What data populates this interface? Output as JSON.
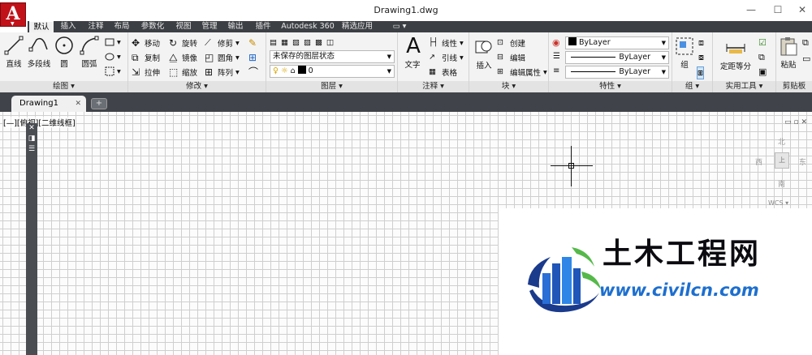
{
  "window": {
    "title": "Drawing1.dwg",
    "app_button": "A",
    "controls": [
      "—",
      "☐",
      "✕"
    ]
  },
  "menu": {
    "tabs": [
      {
        "label": "默认",
        "active": true
      },
      {
        "label": "插入",
        "active": false
      },
      {
        "label": "注释",
        "active": false
      },
      {
        "label": "布局",
        "active": false
      },
      {
        "label": "参数化",
        "active": false
      },
      {
        "label": "视图",
        "active": false
      },
      {
        "label": "管理",
        "active": false
      },
      {
        "label": "输出",
        "active": false
      },
      {
        "label": "插件",
        "active": false
      },
      {
        "label": "Autodesk 360",
        "active": false
      },
      {
        "label": "精选应用",
        "active": false
      },
      {
        "label": "▭ ▾",
        "active": false
      }
    ]
  },
  "ribbon": {
    "draw": {
      "title": "绘图 ▾",
      "line": "直线",
      "polyline": "多段线",
      "circle": "圆",
      "arc": "圆弧"
    },
    "modify": {
      "title": "修改 ▾",
      "move": "移动",
      "rotate": "旋转",
      "trim": "修剪",
      "copy": "复制",
      "mirror": "镜像",
      "fillet": "圆角",
      "stretch": "拉伸",
      "scale": "缩放",
      "array": "阵列"
    },
    "layers": {
      "title": "图层 ▾",
      "layer_state": "未保存的图层状态",
      "current_layer": "0"
    },
    "annotation": {
      "title": "注释 ▾",
      "text": "文字",
      "linear": "线性",
      "leader": "引线",
      "table": "表格"
    },
    "block": {
      "title": "块 ▾",
      "insert": "插入",
      "create": "创建",
      "edit": "编辑",
      "edit_attr": "编辑属性"
    },
    "properties": {
      "title": "特性 ▾",
      "color": "ByLayer",
      "linetype": "ByLayer",
      "lineweight": "ByLayer"
    },
    "groups": {
      "title": "组 ▾",
      "group": "组"
    },
    "utilities": {
      "title": "实用工具 ▾",
      "measure": "定距等分"
    },
    "clipboard": {
      "title": "剪贴板",
      "paste": "粘贴"
    }
  },
  "doc_tabs": [
    {
      "label": "Drawing1",
      "close": "✕"
    }
  ],
  "new_tab": "+",
  "viewport": {
    "label": "[—][俯视][二维线框]",
    "controls": "▭ ▫ ✕"
  },
  "palette": {
    "buttons": [
      "✕",
      "◨",
      "☰"
    ]
  },
  "viewcube": {
    "north": "北",
    "south": "南",
    "west": "西",
    "east": "东",
    "face": "上",
    "wcs": "WCS ▾"
  },
  "watermark": {
    "cn": "土木工程网",
    "en": "www.civilcn.com"
  },
  "colors": {
    "menubar": "#3c3f44",
    "ribbon": "#f3f3f3",
    "app_button": "#c1121a",
    "watermark_blue": "#1d6fcf"
  }
}
